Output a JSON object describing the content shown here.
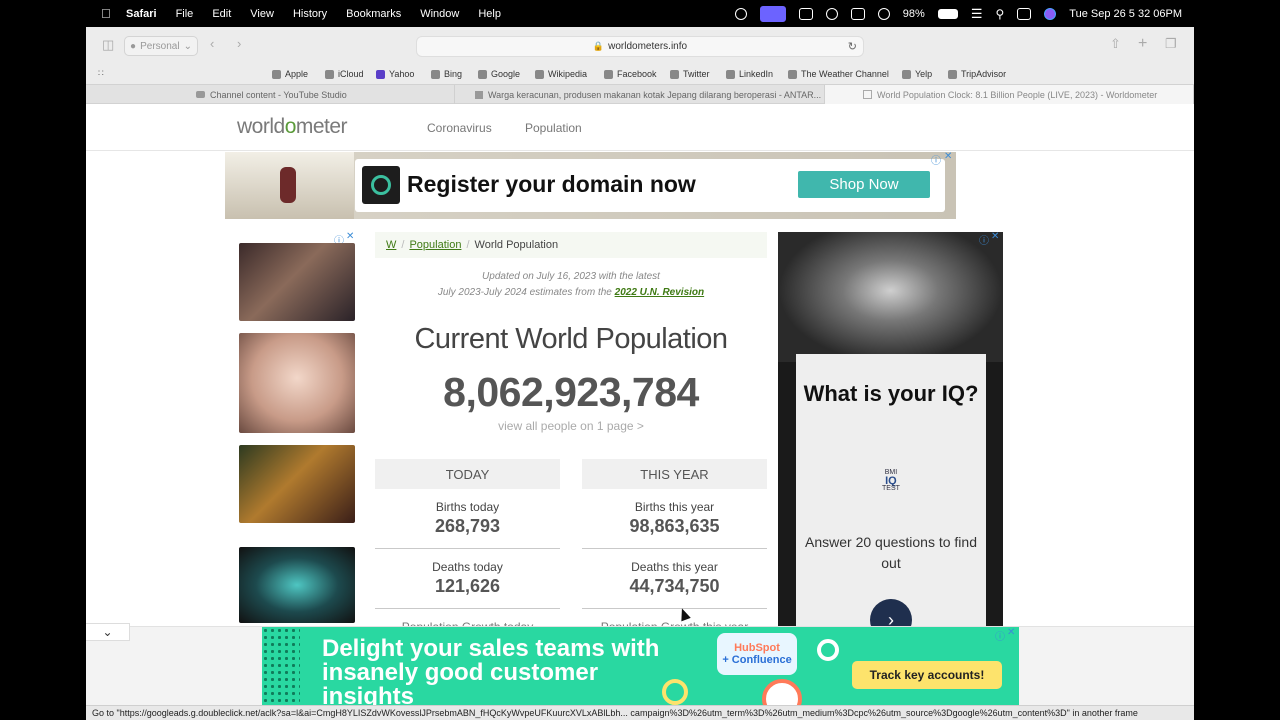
{
  "menubar": {
    "app": "Safari",
    "menus": [
      "File",
      "Edit",
      "View",
      "History",
      "Bookmarks",
      "Window",
      "Help"
    ],
    "battery": "98%",
    "datetime": "Tue Sep 26  5 32 06PM"
  },
  "toolbar": {
    "profile": "Personal",
    "url": "worldometers.info"
  },
  "favorites": [
    "Apple",
    "iCloud",
    "Yahoo",
    "Bing",
    "Google",
    "Wikipedia",
    "Facebook",
    "Twitter",
    "LinkedIn",
    "The Weather Channel",
    "Yelp",
    "TripAdvisor"
  ],
  "tabs": [
    {
      "title": "Channel content - YouTube Studio"
    },
    {
      "title": "Warga keracunan, produsen makanan kotak Jepang dilarang beroperasi - ANTAR..."
    },
    {
      "title": "World Population Clock: 8.1 Billion People (LIVE, 2023) - Worldometer"
    }
  ],
  "site": {
    "logo_pre": "world",
    "logo_o": "o",
    "logo_post": "meter",
    "nav": [
      "Coronavirus",
      "Population"
    ]
  },
  "ad_top": {
    "headline": "Register your domain now",
    "button": "Shop Now"
  },
  "breadcrumb": {
    "home": "W",
    "section": "Population",
    "current": "World Population"
  },
  "updated": {
    "line1": "Updated on July 16, 2023 with the latest",
    "line2_prefix": "July 2023-July 2024 estimates from the ",
    "link": "2022 U.N. Revision"
  },
  "main": {
    "label": "Current World Population",
    "population": "8,062,923,784",
    "view_all": "view all people on 1 page >"
  },
  "today": {
    "header": "TODAY",
    "births_label": "Births today",
    "births_value": "268,793",
    "deaths_label": "Deaths today",
    "deaths_value": "121,626",
    "growth_label": "Population Growth today"
  },
  "this_year": {
    "header": "THIS YEAR",
    "births_label": "Births this year",
    "births_value": "98,863,635",
    "deaths_label": "Deaths this year",
    "deaths_value": "44,734,750",
    "growth_label": "Population Growth this year"
  },
  "ad_right": {
    "question": "What is your IQ?",
    "brand_small": "BMI",
    "brand": "IQ",
    "brand_sub": "TEST",
    "answer": "Answer 20 questions to find out"
  },
  "ad_bottom": {
    "headline": "Delight your sales teams with insanely good customer insights",
    "brand": "HubSpot",
    "brand_sub": "+ Confluence",
    "button": "Track key accounts!"
  },
  "statusbar": "Go to \"https://googleads.g.doubleclick.net/aclk?sa=l&ai=CmgH8YLISZdvWKovesslJPrsebmABN_fHQcKyWvpeUFKuurcXVLxABlLbh... campaign%3D%26utm_term%3D%26utm_medium%3Dcpc%26utm_source%3Dgoogle%26utm_content%3D\" in another frame"
}
